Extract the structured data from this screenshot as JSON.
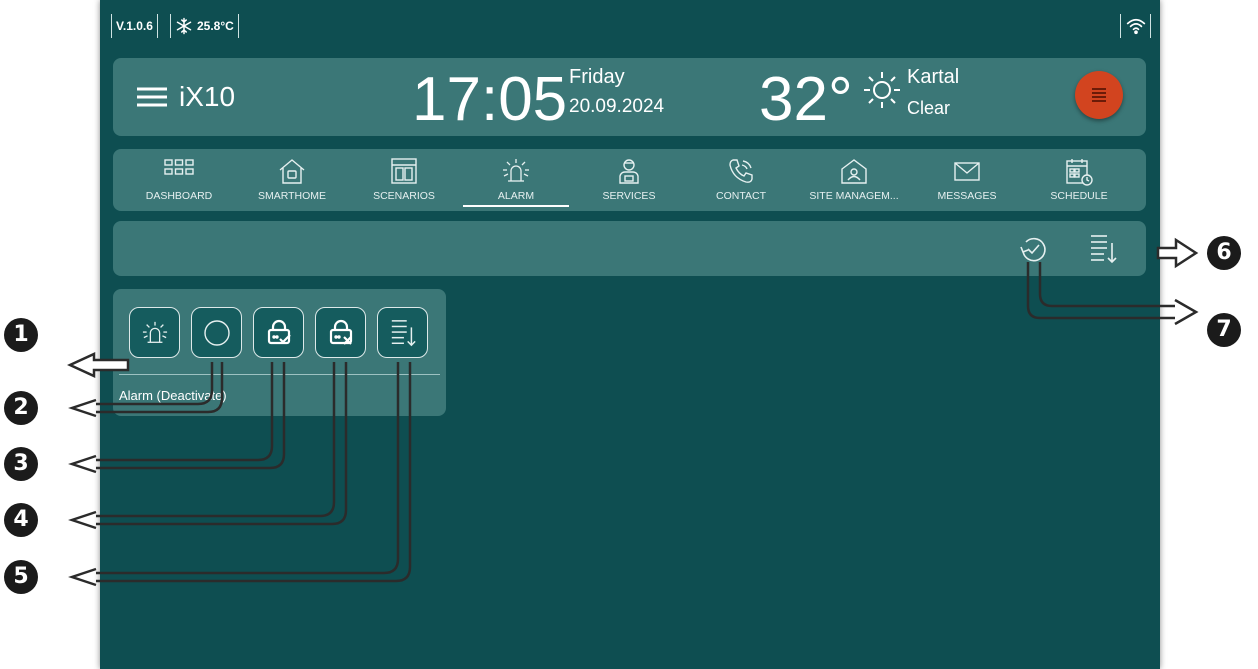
{
  "status_bar": {
    "version": "V.1.0.6",
    "temperature": "25.8°C",
    "climate_icon": "snowflake-icon",
    "wifi_icon": "wifi-icon"
  },
  "header": {
    "brand": "iX10",
    "time": "17:05",
    "weekday": "Friday",
    "date": "20.09.2024",
    "outdoor_temp": "32°",
    "city": "Kartal",
    "condition": "Clear",
    "weather_icon": "sun-icon",
    "menu_icon": "hamburger-icon"
  },
  "nav": {
    "items": [
      {
        "label": "DASHBOARD",
        "icon": "dashboard-grid-icon"
      },
      {
        "label": "SMARTHOME",
        "icon": "home-icon"
      },
      {
        "label": "SCENARIOS",
        "icon": "scenario-icon"
      },
      {
        "label": "ALARM",
        "icon": "alarm-icon",
        "active": true
      },
      {
        "label": "SERVICES",
        "icon": "service-person-icon"
      },
      {
        "label": "CONTACT",
        "icon": "phone-icon"
      },
      {
        "label": "SITE MANAGEM...",
        "icon": "site-management-icon"
      },
      {
        "label": "MESSAGES",
        "icon": "envelope-icon"
      },
      {
        "label": "SCHEDULE",
        "icon": "calendar-icon"
      }
    ]
  },
  "toolbar": {
    "history_icon": "history-icon",
    "log_icon": "sort-list-icon"
  },
  "alarm_card": {
    "status_label": "Alarm (Deactivate)",
    "buttons": [
      {
        "icon": "alarm-icon"
      },
      {
        "icon": "circle-icon"
      },
      {
        "icon": "lock-check-icon"
      },
      {
        "icon": "lock-x-icon"
      },
      {
        "icon": "sort-list-icon"
      }
    ]
  },
  "callouts": [
    "1",
    "2",
    "3",
    "4",
    "5",
    "6",
    "7"
  ]
}
